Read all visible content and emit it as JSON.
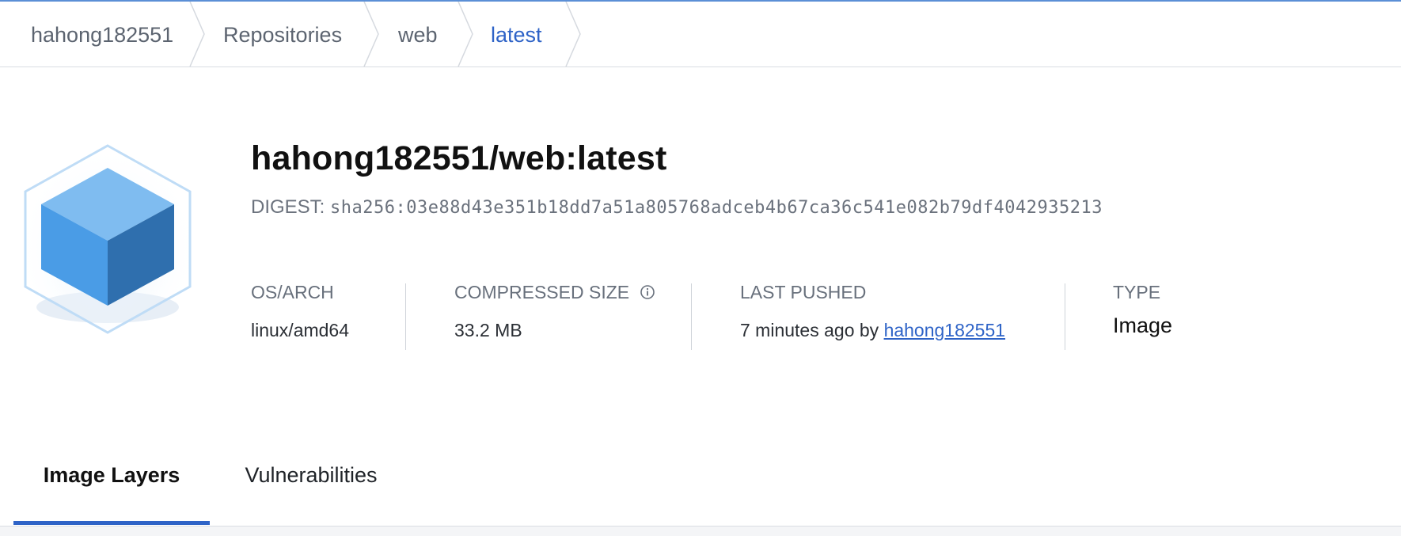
{
  "breadcrumb": {
    "items": [
      {
        "label": "hahong182551"
      },
      {
        "label": "Repositories"
      },
      {
        "label": "web"
      },
      {
        "label": "latest"
      }
    ]
  },
  "header": {
    "title": "hahong182551/web:latest",
    "digest_label": "DIGEST:",
    "digest_value": "sha256:03e88d43e351b18dd7a51a805768adceb4b67ca36c541e082b79df4042935213"
  },
  "meta": {
    "os_arch": {
      "label": "OS/ARCH",
      "value": "linux/amd64"
    },
    "compressed_size": {
      "label": "COMPRESSED SIZE",
      "value": "33.2 MB",
      "icon": "info-icon"
    },
    "last_pushed": {
      "label": "LAST PUSHED",
      "value_prefix": "7 minutes ago by",
      "user": "hahong182551"
    },
    "type": {
      "label": "TYPE",
      "value": "Image"
    }
  },
  "tabs": [
    {
      "label": "Image Layers",
      "active": true
    },
    {
      "label": "Vulnerabilities",
      "active": false
    }
  ],
  "colors": {
    "accent": "#2e63c7",
    "cube_top": "#7fbcf0",
    "cube_left": "#4a9ce6",
    "cube_right": "#2f6fae"
  }
}
